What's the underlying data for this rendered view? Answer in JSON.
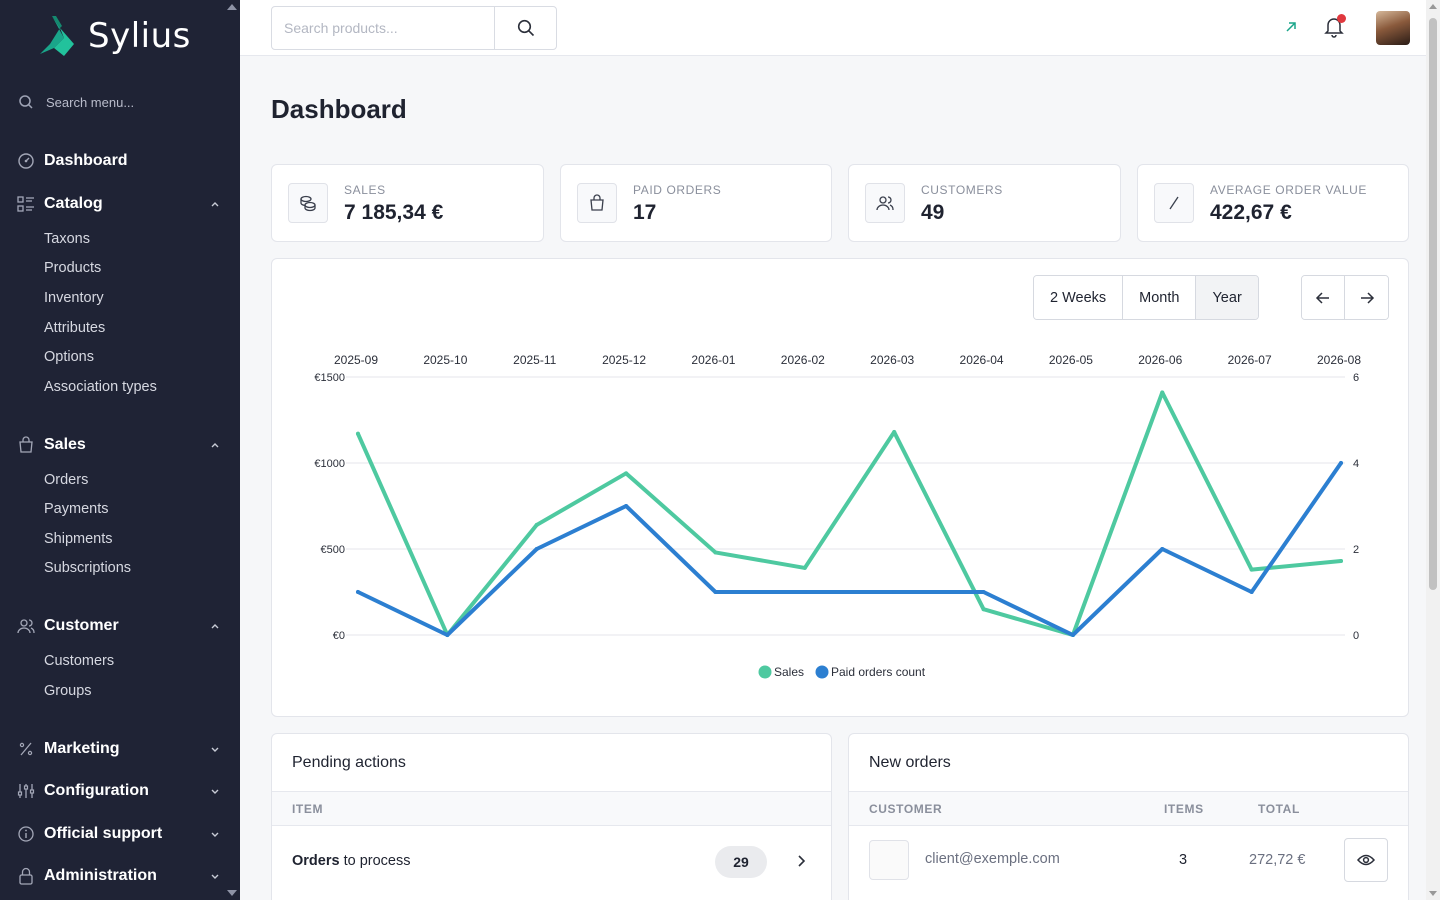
{
  "app": {
    "logo_text": "Sylius"
  },
  "sidebar": {
    "search_placeholder": "Search menu...",
    "sections": [
      {
        "label": "Dashboard",
        "icon": "dashboard-icon",
        "items": []
      },
      {
        "label": "Catalog",
        "icon": "catalog-icon",
        "expanded": true,
        "items": [
          "Taxons",
          "Products",
          "Inventory",
          "Attributes",
          "Options",
          "Association types"
        ]
      },
      {
        "label": "Sales",
        "icon": "shopping-bag-icon",
        "expanded": true,
        "items": [
          "Orders",
          "Payments",
          "Shipments",
          "Subscriptions"
        ]
      },
      {
        "label": "Customer",
        "icon": "users-icon",
        "expanded": true,
        "items": [
          "Customers",
          "Groups"
        ]
      },
      {
        "label": "Marketing",
        "icon": "percent-icon",
        "expanded": false,
        "items": []
      },
      {
        "label": "Configuration",
        "icon": "sliders-icon",
        "expanded": false,
        "items": []
      },
      {
        "label": "Official support",
        "icon": "info-icon",
        "expanded": false,
        "items": []
      },
      {
        "label": "Administration",
        "icon": "lock-icon",
        "expanded": false,
        "items": []
      }
    ]
  },
  "topbar": {
    "search_placeholder": "Search products..."
  },
  "page": {
    "title": "Dashboard"
  },
  "stats": [
    {
      "label": "SALES",
      "value": "7 185,34 €",
      "icon": "coins-icon"
    },
    {
      "label": "PAID ORDERS",
      "value": "17",
      "icon": "shopping-bag-icon"
    },
    {
      "label": "CUSTOMERS",
      "value": "49",
      "icon": "users-icon"
    },
    {
      "label": "AVERAGE ORDER VALUE",
      "value": "422,67 €",
      "icon": "slash-icon"
    }
  ],
  "chart_controls": {
    "periods": [
      "2 Weeks",
      "Month",
      "Year"
    ],
    "selected": "Year"
  },
  "chart_data": {
    "type": "line",
    "categories": [
      "2025-09",
      "2025-10",
      "2025-11",
      "2025-12",
      "2026-01",
      "2026-02",
      "2026-03",
      "2026-04",
      "2026-05",
      "2026-06",
      "2026-07",
      "2026-08"
    ],
    "series": [
      {
        "name": "Sales",
        "axis": "left",
        "color": "#4ec9a0",
        "values": [
          1170,
          0,
          640,
          940,
          480,
          390,
          1180,
          150,
          0,
          1410,
          380,
          430
        ]
      },
      {
        "name": "Paid orders count",
        "axis": "right",
        "color": "#2c7fd1",
        "values": [
          1,
          0,
          2,
          3,
          1,
          1,
          1,
          1,
          0,
          2,
          1,
          4
        ]
      }
    ],
    "y_left": {
      "ticks": [
        "€0",
        "€500",
        "€1000",
        "€1500"
      ],
      "range": [
        0,
        1500
      ]
    },
    "y_right": {
      "ticks": [
        "0",
        "2",
        "4",
        "6"
      ],
      "range": [
        0,
        6
      ]
    },
    "x_axis_position": "top",
    "legend_position": "bottom-center",
    "grid": true
  },
  "pending_actions": {
    "title": "Pending actions",
    "column": "ITEM",
    "rows": [
      {
        "label_bold": "Orders",
        "label_rest": " to process",
        "count": "29"
      }
    ]
  },
  "new_orders": {
    "title": "New orders",
    "columns": [
      "CUSTOMER",
      "ITEMS",
      "TOTAL"
    ],
    "rows": [
      {
        "customer": "client@exemple.com",
        "items": "3",
        "total": "272,72 €"
      }
    ]
  }
}
